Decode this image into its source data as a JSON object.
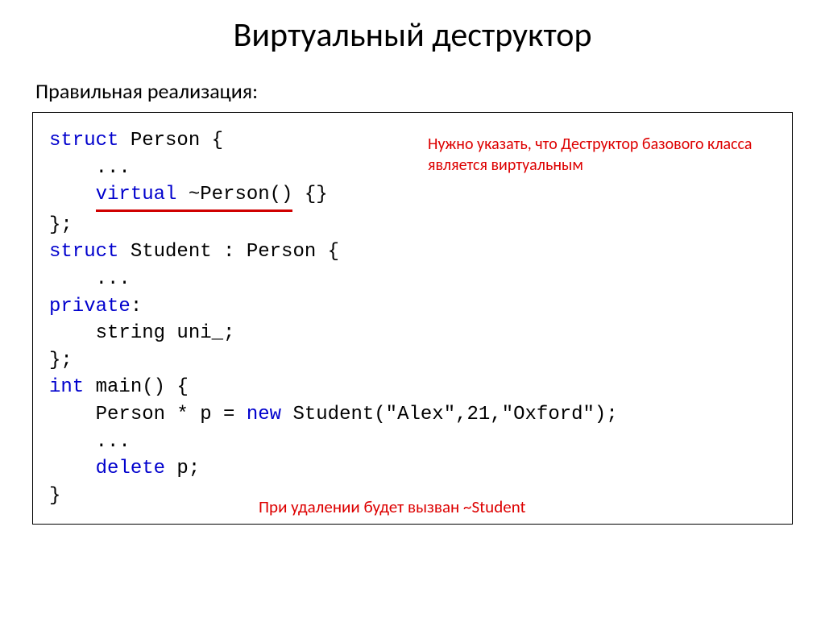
{
  "title": "Виртуальный деструктор",
  "subtitle": "Правильная реализация:",
  "code": {
    "l1a": "struct",
    "l1b": " Person {",
    "l2": "    ...",
    "l3a": "    ",
    "l3b": "virtual",
    "l3c": " ~Person()",
    "l3d": " {}",
    "l4": "};",
    "l5a": "struct",
    "l5b": " Student : Person {",
    "l6": "    ...",
    "l7a": "private",
    "l7b": ":",
    "l8": "    string uni_;",
    "l9": "};",
    "l10": "",
    "l11a": "int",
    "l11b": " main() {",
    "l12a": "    Person * p = ",
    "l12b": "new",
    "l12c": " Student(\"Alex\",21,\"Oxford\");",
    "l13": "    ...",
    "l14a": "    ",
    "l14b": "delete",
    "l14c": " p;",
    "l15": "}"
  },
  "annotations": {
    "top": "Нужно указать, что Деструктор базового класса является виртуальным",
    "bottom": "При удалении будет вызван ~Student"
  }
}
